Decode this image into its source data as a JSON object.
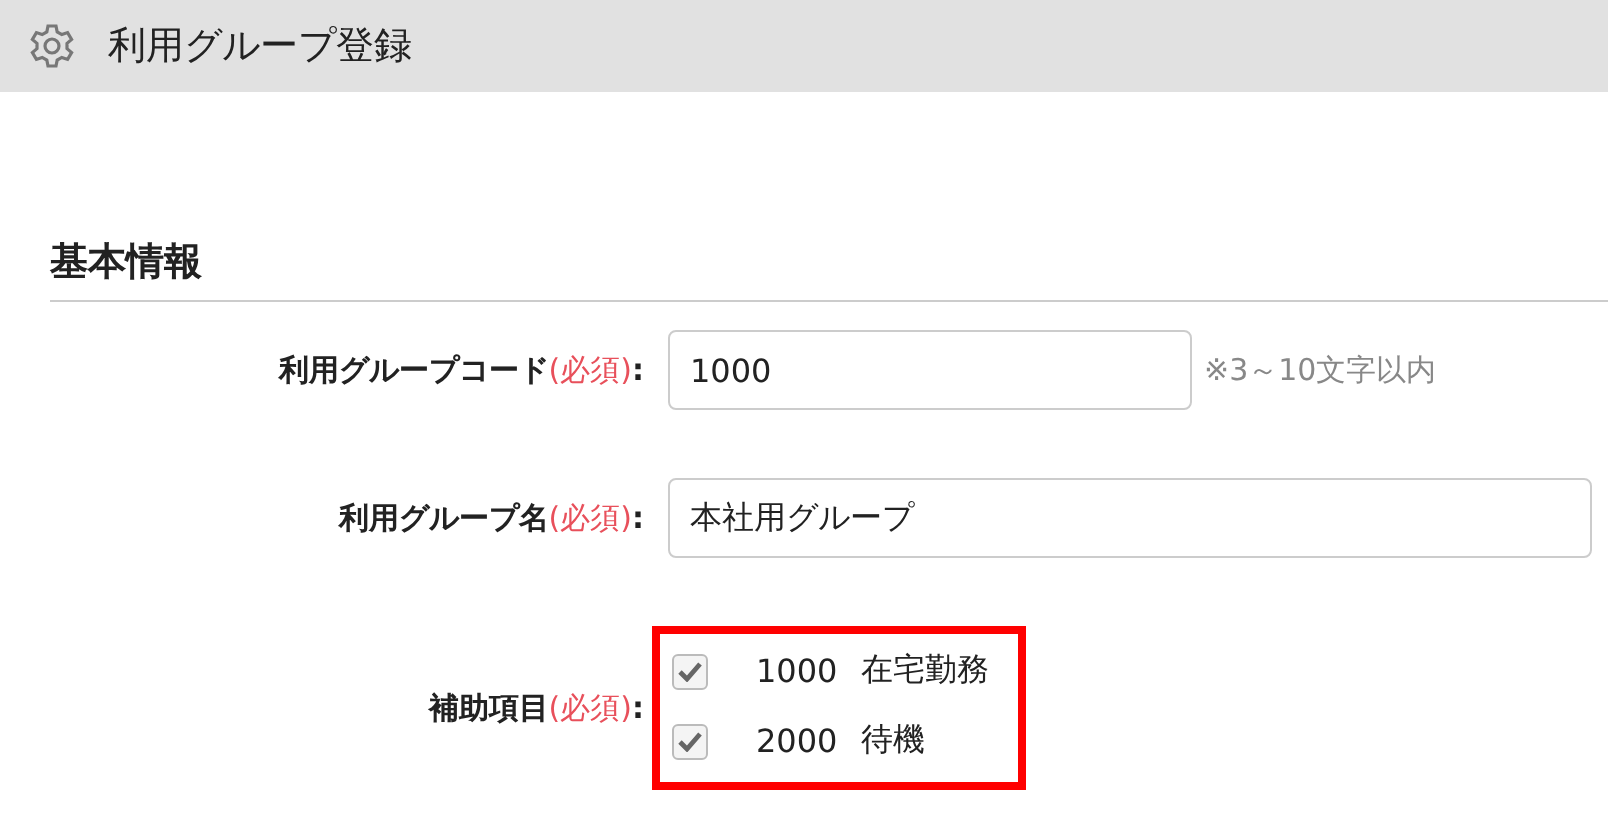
{
  "header": {
    "title": "利用グループ登録"
  },
  "section": {
    "title": "基本情報"
  },
  "fields": [
    {
      "kind": "text",
      "label": "利用グループコード",
      "required": "(必須)",
      "colon": ":",
      "value": "1000",
      "hint": "※3～10文字以内"
    },
    {
      "kind": "text",
      "label": "利用グループ名",
      "required": "(必須)",
      "colon": ":",
      "value": "本社用グループ"
    },
    {
      "kind": "checks",
      "label": "補助項目",
      "required": "(必須)",
      "colon": ":",
      "highlighted": true,
      "options": [
        {
          "checked": true,
          "code": "1000",
          "name": "在宅勤務"
        },
        {
          "checked": true,
          "code": "2000",
          "name": "待機"
        }
      ]
    }
  ]
}
